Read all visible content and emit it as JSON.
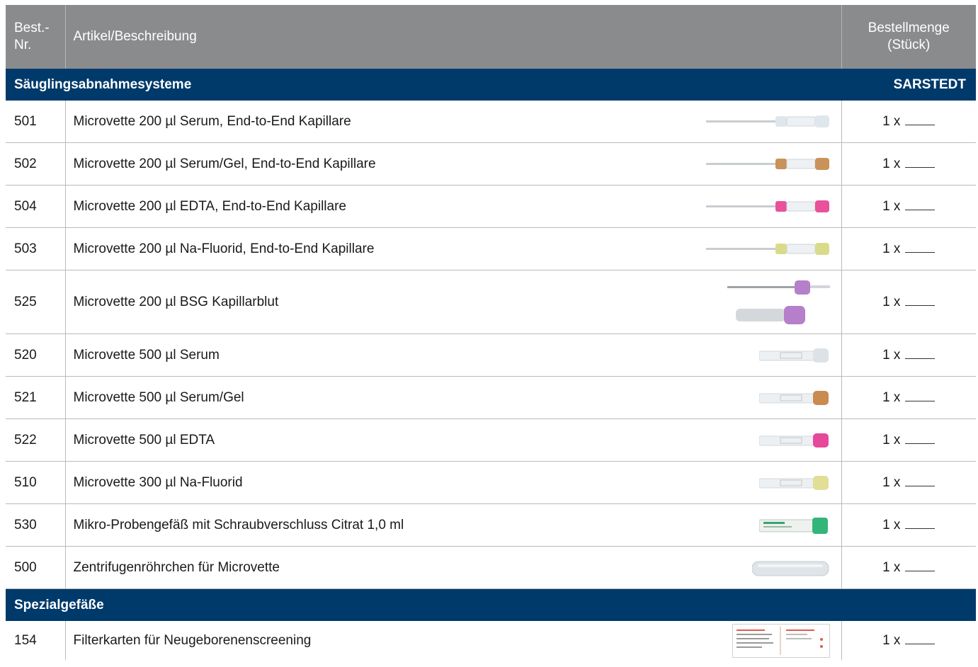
{
  "header": {
    "col_number": "Best.-\nNr.",
    "col_number_line1": "Best.-",
    "col_number_line2": "Nr.",
    "col_article": "Artikel/Beschreibung",
    "col_qty_line1": "Bestellmenge",
    "col_qty_line2": "(Stück)"
  },
  "sections": [
    {
      "title": "Säuglingsabnahmesysteme",
      "brand": "SARSTEDT",
      "items": [
        {
          "number": "501",
          "description": "Microvette 200 µl Serum, End-to-End Kapillare",
          "qty_prefix": "1 x",
          "image": "capillary-tube-white-cap",
          "cap_color": "#dfe7ec"
        },
        {
          "number": "502",
          "description": "Microvette 200 µl Serum/Gel, End-to-End Kapillare",
          "qty_prefix": "1 x",
          "image": "capillary-tube-brown-cap",
          "cap_color": "#c8925a"
        },
        {
          "number": "504",
          "description": "Microvette 200 µl EDTA, End-to-End Kapillare",
          "qty_prefix": "1 x",
          "image": "capillary-tube-pink-cap",
          "cap_color": "#e9519a"
        },
        {
          "number": "503",
          "description": "Microvette 200 µl Na-Fluorid, End-to-End Kapillare",
          "qty_prefix": "1 x",
          "image": "capillary-tube-yellow-cap",
          "cap_color": "#d9db8a"
        },
        {
          "number": "525",
          "description": "Microvette 200 µl BSG Kapillarblut",
          "qty_prefix": "1 x",
          "image": "bsg-capillary-violet-cap",
          "cap_color": "#b57fc9"
        },
        {
          "number": "520",
          "description": "Microvette 500 µl Serum",
          "qty_prefix": "1 x",
          "image": "tube-white-cap",
          "cap_color": "#dde2e6"
        },
        {
          "number": "521",
          "description": "Microvette 500 µl Serum/Gel",
          "qty_prefix": "1 x",
          "image": "tube-brown-cap",
          "cap_color": "#c98b4f"
        },
        {
          "number": "522",
          "description": "Microvette 500 µl EDTA",
          "qty_prefix": "1 x",
          "image": "tube-pink-cap",
          "cap_color": "#e6489a"
        },
        {
          "number": "510",
          "description": "Microvette 300 µl Na-Fluorid",
          "qty_prefix": "1 x",
          "image": "tube-yellow-cap",
          "cap_color": "#e1de96"
        },
        {
          "number": "530",
          "description": "Mikro-Probengefäß mit Schraubverschluss Citrat 1,0 ml",
          "qty_prefix": "1 x",
          "image": "screw-cap-tube-green",
          "cap_color": "#33b57a"
        },
        {
          "number": "500",
          "description": "Zentrifugenröhrchen für Microvette",
          "qty_prefix": "1 x",
          "image": "centrifuge-tube-clear",
          "cap_color": "#d7dde2"
        }
      ]
    },
    {
      "title": "Spezialgefäße",
      "brand": "",
      "items": [
        {
          "number": "154",
          "description": "Filterkarten für Neugeborenenscreening",
          "qty_prefix": "1 x",
          "image": "filter-card",
          "cap_color": "#e35b4b"
        }
      ]
    }
  ],
  "colors": {
    "header_bg": "#8a8b8d",
    "section_bg": "#003a6b",
    "grid_line": "#b9babc"
  }
}
